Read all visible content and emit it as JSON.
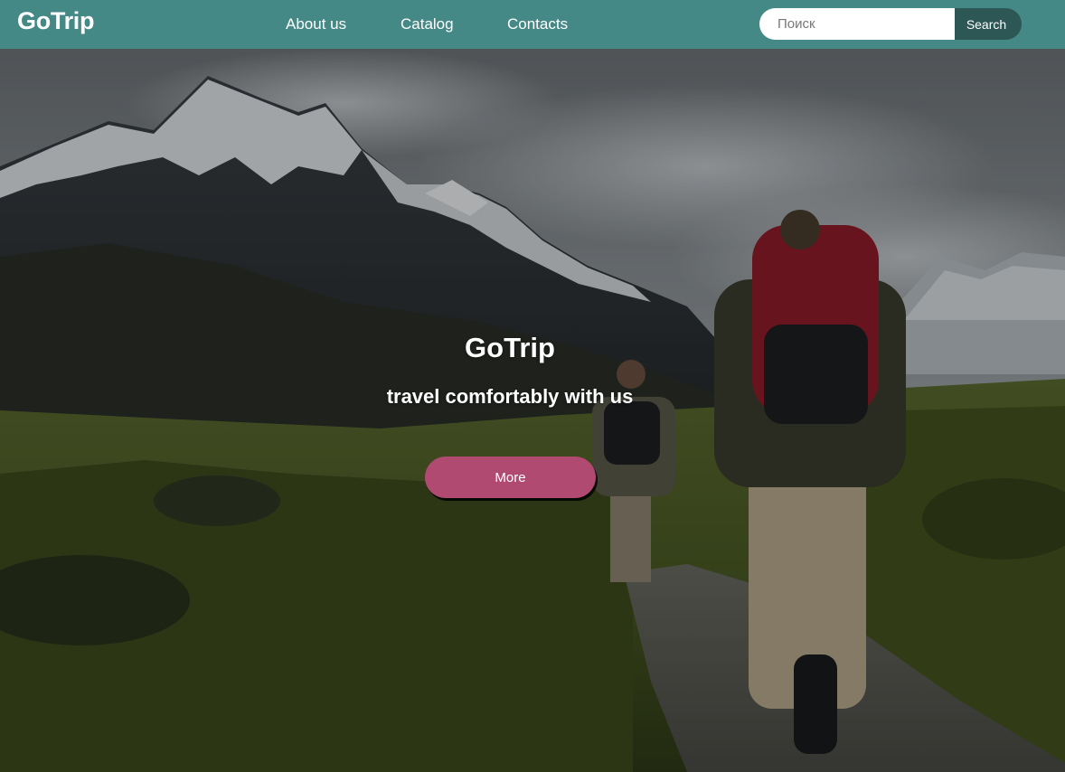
{
  "header": {
    "logo": "GoTrip",
    "nav": [
      {
        "label": "About us"
      },
      {
        "label": "Catalog"
      },
      {
        "label": "Contacts"
      }
    ],
    "search": {
      "placeholder": "Поиск",
      "value": "",
      "button_label": "Search"
    }
  },
  "hero": {
    "title": "GoTrip",
    "subtitle": "travel comfortably with us",
    "button_label": "More",
    "background_image": "mountain-hikers-photo"
  },
  "colors": {
    "header_bg": "#458987",
    "search_button_bg": "#2d5754",
    "accent_button": "#b04a70",
    "text": "#ffffff"
  }
}
